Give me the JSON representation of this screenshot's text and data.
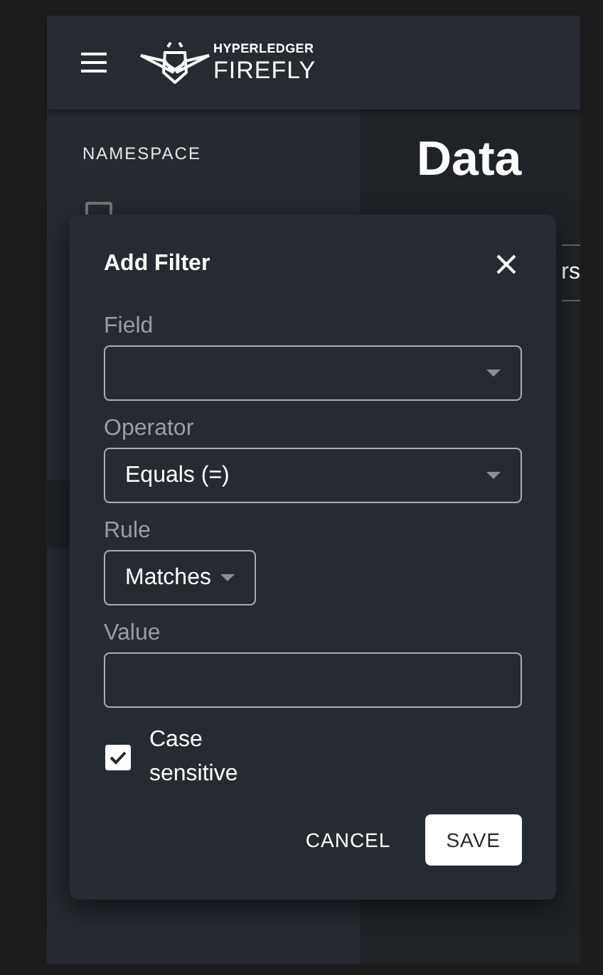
{
  "app_bar": {
    "logo": {
      "top": "HYPERLEDGER",
      "bottom": "FIREFLY"
    }
  },
  "sidebar": {
    "heading": "NAMESPACE",
    "namespace_checkbox": {
      "checked": false
    }
  },
  "main": {
    "title": "Data",
    "tab_fragment": "rs"
  },
  "dialog": {
    "title": "Add Filter",
    "fields": [
      {
        "kind": "select",
        "label": "Field"
      },
      {
        "kind": "select",
        "label": "Operator",
        "value": "Equals (=)"
      },
      {
        "kind": "select-small",
        "label": "Rule",
        "value": "Matches"
      },
      {
        "kind": "text",
        "label": "Value"
      }
    ],
    "case_sensitive": {
      "label": "Case sensitive",
      "checked": true
    },
    "buttons": [
      {
        "kind": "text",
        "label": "CANCEL"
      },
      {
        "kind": "contained",
        "label": "SAVE"
      }
    ]
  }
}
